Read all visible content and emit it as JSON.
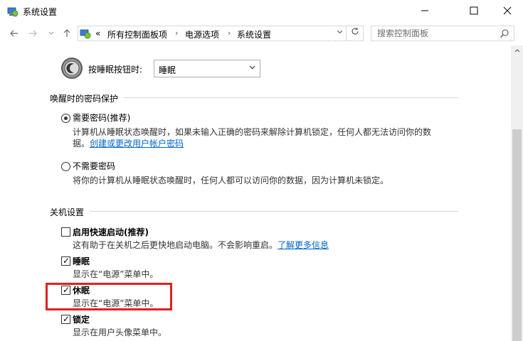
{
  "window": {
    "title": "系统设置",
    "minimize_icon": "minimize-icon",
    "maximize_icon": "maximize-icon",
    "close_icon": "close-icon"
  },
  "nav": {
    "back_icon": "back-arrow-icon",
    "forward_icon": "forward-arrow-icon",
    "recent_icon": "chevron-down-icon",
    "up_icon": "up-arrow-icon"
  },
  "address": {
    "overflow": "«",
    "crumbs": [
      "所有控制面板项",
      "电源选项",
      "系统设置"
    ],
    "separator": "›"
  },
  "search": {
    "placeholder": "搜索控制面板"
  },
  "sleep_button": {
    "label": "按睡眠按钮时:",
    "value": "睡眠"
  },
  "password_section": {
    "title": "唤醒时的密码保护",
    "option1": {
      "label": "需要密码(推荐)",
      "desc_line1": "计算机从睡眠状态唤醒时，如果未输入正确的密码来解除计算机锁定，任何人都无法访问你的数",
      "desc_line2": "据。",
      "link": "创建或更改用户帐户密码",
      "selected": true
    },
    "option2": {
      "label": "不需要密码",
      "desc": "将你的计算机从睡眠状态唤醒时，任何人都可以访问你的数据，因为计算机未锁定。",
      "selected": false
    }
  },
  "shutdown_section": {
    "title": "关机设置",
    "fast_startup": {
      "label": "启用快速启动(推荐)",
      "desc": "这有助于在关机之后更快地启动电脑。不会影响重启。",
      "link": "了解更多信息",
      "checked": false
    },
    "sleep": {
      "label": "睡眠",
      "desc": "显示在“电源”菜单中。",
      "checked": true
    },
    "hibernate": {
      "label": "休眠",
      "desc": "显示在“电源”菜单中。",
      "checked": true
    },
    "lock": {
      "label": "锁定",
      "desc": "显示在用户头像菜单中。",
      "checked": true
    }
  },
  "colors": {
    "highlight": "#e02020",
    "link": "#0066cc"
  }
}
